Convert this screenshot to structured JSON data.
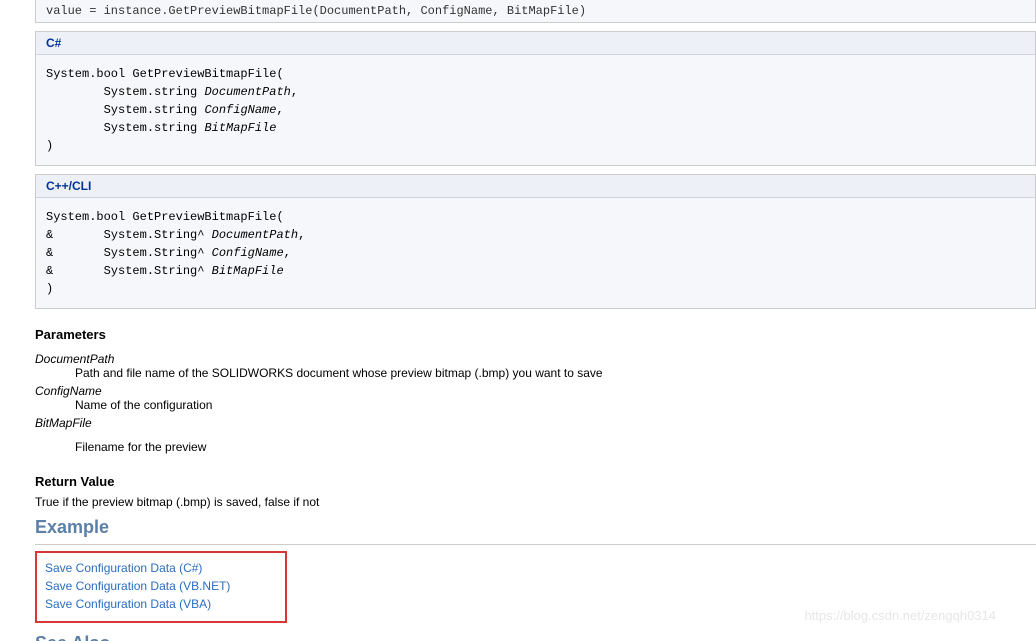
{
  "top_line": "value = instance.GetPreviewBitmapFile(DocumentPath, ConfigName, BitMapFile)",
  "csharp": {
    "header": "C#",
    "sig1": "System.bool GetPreviewBitmapFile(",
    "arg1": "        System.string ",
    "arg1i": "DocumentPath",
    "arg1e": ",",
    "arg2": "        System.string ",
    "arg2i": "ConfigName",
    "arg2e": ",",
    "arg3": "        System.string ",
    "arg3i": "BitMapFile",
    "close": ")"
  },
  "cpp": {
    "header": "C++/CLI",
    "sig1": "System.bool GetPreviewBitmapFile(",
    "arg1a": "&       System.String^ ",
    "arg1i": "DocumentPath",
    "arg1e": ",",
    "arg2a": "&       System.String^ ",
    "arg2i": "ConfigName",
    "arg2e": ",",
    "arg3a": "&       System.String^ ",
    "arg3i": "BitMapFile",
    "close": ")"
  },
  "params": {
    "heading": "Parameters",
    "p1name": "DocumentPath",
    "p1desc": "Path and file name of the SOLIDWORKS document whose preview bitmap (.bmp) you want to save",
    "p2name": "ConfigName",
    "p2desc": "Name of the configuration",
    "p3name": "BitMapFile",
    "p3desc": "Filename for the preview"
  },
  "return": {
    "heading": "Return Value",
    "desc": "True if the preview bitmap (.bmp) is saved, false if not"
  },
  "example": {
    "heading": "Example",
    "link1": "Save Configuration Data (C#)",
    "link2": "Save Configuration Data (VB.NET)",
    "link3": "Save Configuration Data (VBA)"
  },
  "see_also": "See Also",
  "watermark": "https://blog.csdn.net/zengqh0314"
}
